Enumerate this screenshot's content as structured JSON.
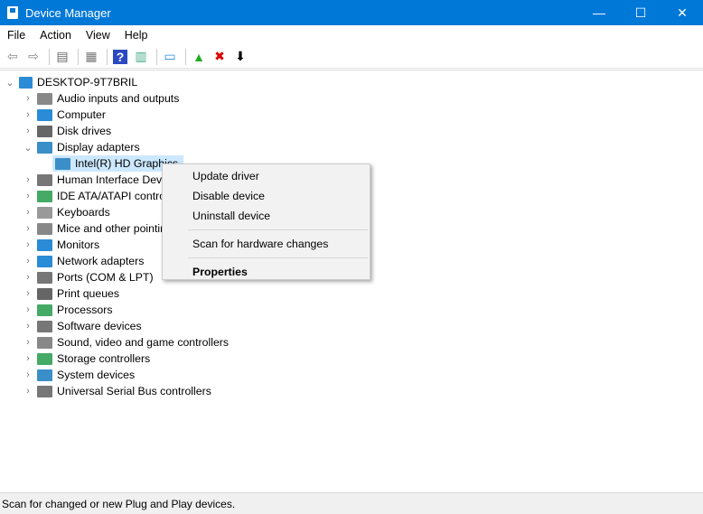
{
  "window": {
    "title": "Device Manager",
    "minimize": "—",
    "maximize": "☐",
    "close": "✕"
  },
  "menu": [
    "File",
    "Action",
    "View",
    "Help"
  ],
  "toolbar": [
    {
      "name": "back-icon",
      "glyph": "⇦",
      "color": "#888"
    },
    {
      "name": "forward-icon",
      "glyph": "⇨",
      "color": "#888"
    },
    {
      "name": "console-tree-icon",
      "glyph": "▤",
      "color": "#666"
    },
    {
      "name": "properties-icon",
      "glyph": "▦",
      "color": "#777"
    },
    {
      "name": "help-icon",
      "glyph": "?",
      "color": "#2a49c2"
    },
    {
      "name": "action-pane-icon",
      "glyph": "▥",
      "color": "#4a8"
    },
    {
      "name": "scan-hardware-icon",
      "glyph": "▭",
      "color": "#2a8bd6"
    },
    {
      "name": "update-driver-icon",
      "glyph": "▲",
      "color": "#2a2"
    },
    {
      "name": "uninstall-icon",
      "glyph": "✖",
      "color": "#d00"
    },
    {
      "name": "disable-icon",
      "glyph": "⬇",
      "color": "#000"
    }
  ],
  "tree": {
    "root": "DESKTOP-9T7BRIL",
    "items": [
      {
        "label": "Audio inputs and outputs",
        "color": "#888",
        "expanded": false
      },
      {
        "label": "Computer",
        "color": "#2a8bd6",
        "expanded": false
      },
      {
        "label": "Disk drives",
        "color": "#666",
        "expanded": false
      },
      {
        "label": "Display adapters",
        "color": "#3a8fc8",
        "expanded": true,
        "child": "Intel(R) HD Graphics"
      },
      {
        "label": "Human Interface Devices",
        "color": "#777",
        "expanded": false
      },
      {
        "label": "IDE ATA/ATAPI controllers",
        "color": "#4a6",
        "expanded": false
      },
      {
        "label": "Keyboards",
        "color": "#999",
        "expanded": false
      },
      {
        "label": "Mice and other pointing devices",
        "color": "#888",
        "expanded": false
      },
      {
        "label": "Monitors",
        "color": "#2a8bd6",
        "expanded": false
      },
      {
        "label": "Network adapters",
        "color": "#2a8bd6",
        "expanded": false
      },
      {
        "label": "Ports (COM & LPT)",
        "color": "#777",
        "expanded": false
      },
      {
        "label": "Print queues",
        "color": "#666",
        "expanded": false
      },
      {
        "label": "Processors",
        "color": "#4a6",
        "expanded": false
      },
      {
        "label": "Software devices",
        "color": "#777",
        "expanded": false
      },
      {
        "label": "Sound, video and game controllers",
        "color": "#888",
        "expanded": false
      },
      {
        "label": "Storage controllers",
        "color": "#4a6",
        "expanded": false
      },
      {
        "label": "System devices",
        "color": "#3a8fc8",
        "expanded": false
      },
      {
        "label": "Universal Serial Bus controllers",
        "color": "#777",
        "expanded": false
      }
    ]
  },
  "context_menu": {
    "update": "Update driver",
    "disable": "Disable device",
    "uninstall": "Uninstall device",
    "scan": "Scan for hardware changes",
    "properties": "Properties"
  },
  "status": "Scan for changed or new Plug and Play devices."
}
